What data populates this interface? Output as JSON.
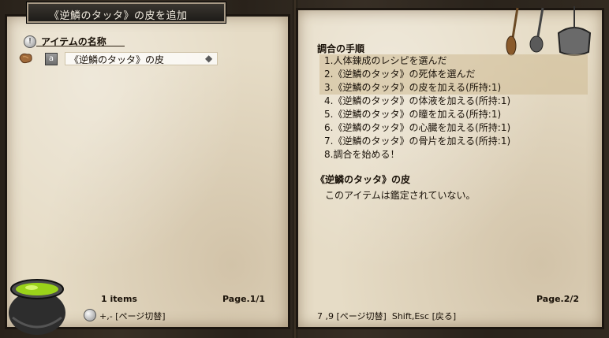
{
  "window": {
    "title": "《逆鱗のタッタ》の皮を追加"
  },
  "left_panel": {
    "header": "アイテムの名称",
    "items": [
      {
        "slot": "a",
        "name": "《逆鱗のタッタ》の皮"
      }
    ],
    "count_text": "1 items",
    "page_text": "Page.1/1",
    "hint": "+,- [ページ切替]"
  },
  "right_panel": {
    "header": "調合の手順",
    "steps": [
      "1.人体錬成のレシピを選んだ",
      "2.《逆鱗のタッタ》の死体を選んだ",
      "3.《逆鱗のタッタ》の皮を加える(所持:1)",
      "4.《逆鱗のタッタ》の体液を加える(所持:1)",
      "5.《逆鱗のタッタ》の瞳を加える(所持:1)",
      "6.《逆鱗のタッタ》の心臓を加える(所持:1)",
      "7.《逆鱗のタッタ》の骨片を加える(所持:1)",
      "8.調合を始める！"
    ],
    "detail_title": "《逆鱗のタッタ》の皮",
    "detail_text": "このアイテムは鑑定されていない。",
    "page_text": "Page.2/2",
    "hint": "7 ,9 [ページ切替]  Shift,Esc [戻る]"
  },
  "colors": {
    "parchment": "#e6dcc6",
    "highlight": "#d9c9a3",
    "title_bg": "#2a2723"
  }
}
